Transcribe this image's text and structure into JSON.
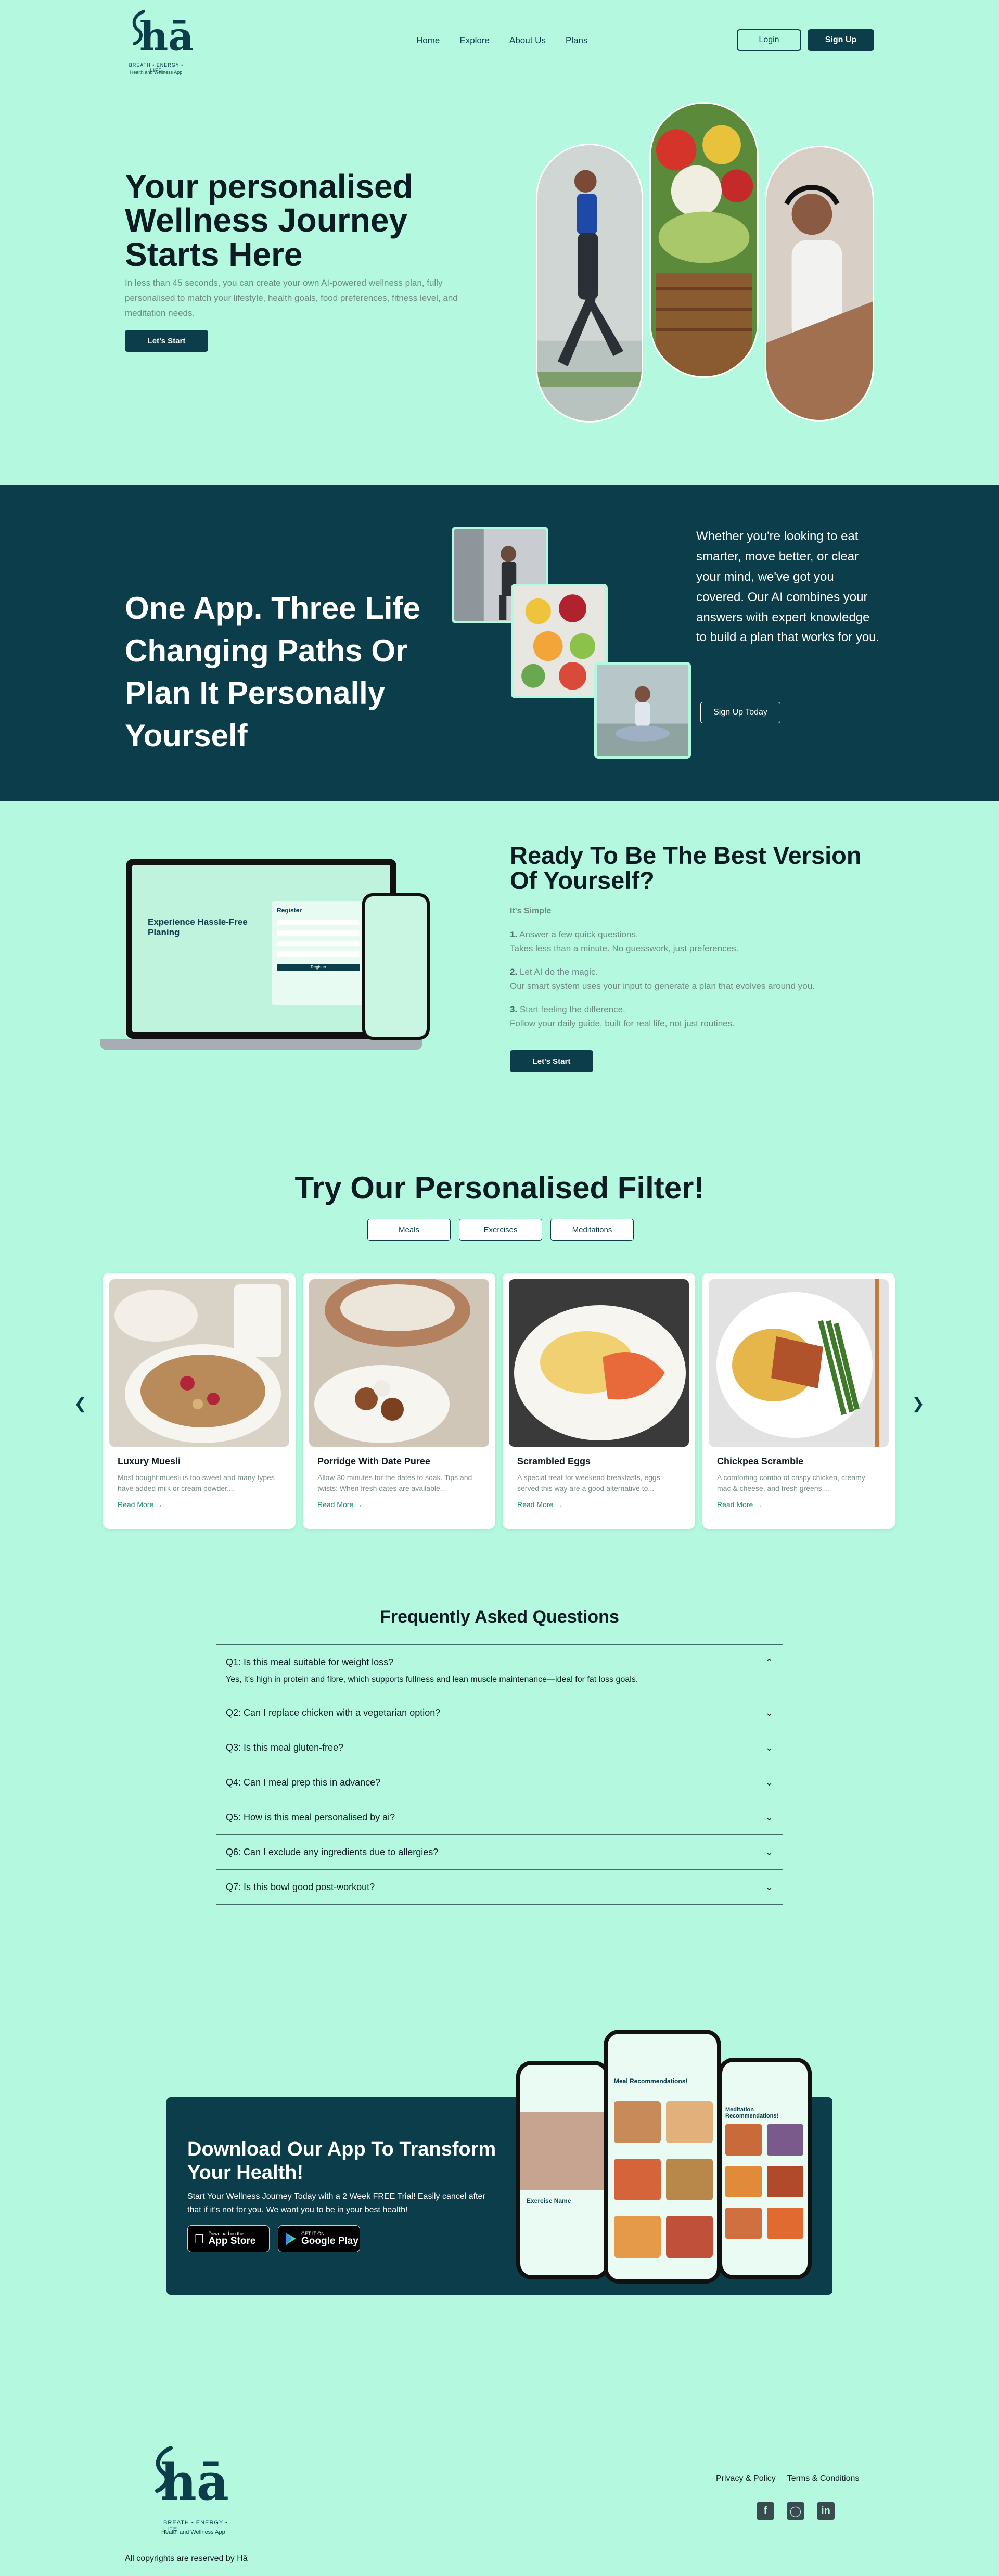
{
  "brand": {
    "logo_mark": "hā",
    "logo_line1": "BREATH • ENERGY • LIFE",
    "logo_line2": "Health and Wellness App"
  },
  "nav": {
    "links": [
      "Home",
      "Explore",
      "About Us",
      "Plans"
    ],
    "login_label": "Login",
    "signup_label": "Sign Up"
  },
  "hero": {
    "title": "Your personalised Wellness Journey Starts Here",
    "description": "In less than 45 seconds, you can create your own AI-powered wellness plan, fully personalised to match your lifestyle, health goals, food preferences, fitness level, and meditation needs.",
    "cta_label": "Let's Start"
  },
  "band": {
    "title": "One App. Three Life Changing Paths Or Plan It Personally Yourself",
    "text": "Whether you're looking to eat smarter, move better, or clear your mind, we've got you covered. Our AI combines your answers with expert knowledge to build a plan that works for you.",
    "cta_label": "Sign Up Today"
  },
  "ready": {
    "title": "Ready To Be The Best Version Of Yourself?",
    "subtitle": "It's Simple",
    "steps": [
      {
        "num": "1.",
        "head": "Answer a few quick questions.",
        "body": "Takes less than a minute. No guesswork, just preferences."
      },
      {
        "num": "2.",
        "head": "Let AI do the magic.",
        "body": "Our smart system uses your input to generate a plan that evolves around you."
      },
      {
        "num": "3.",
        "head": "Start feeling the difference.",
        "body": "Follow your daily guide, built for real life, not just routines."
      }
    ],
    "cta_label": "Let's Start",
    "laptop": {
      "heading": "Experience Hassle-Free Planing",
      "register": "Register",
      "register_button": "Register"
    }
  },
  "filter": {
    "title": "Try Our Personalised Filter!",
    "tabs": [
      "Meals",
      "Exercises",
      "Meditations"
    ],
    "cards": [
      {
        "title": "Luxury Muesli",
        "desc": "Most bought muesli is too sweet and many types have added milk or cream powder....",
        "link": "Read More →"
      },
      {
        "title": "Porridge With Date Puree",
        "desc": "Allow 30 minutes for the dates to soak. Tips and twists: When fresh dates are available...",
        "link": "Read More →"
      },
      {
        "title": "Scrambled Eggs",
        "desc": "A special treat for weekend breakfasts, eggs served this way are a good alternative to...",
        "link": "Read More →"
      },
      {
        "title": "Chickpea Scramble",
        "desc": "A comforting combo of crispy chicken, creamy mac & cheese, and fresh greens,...",
        "link": "Read More →"
      }
    ]
  },
  "faq": {
    "title": "Frequently Asked Questions",
    "items": [
      {
        "q": "Q1: Is this meal suitable for weight loss?",
        "a": "Yes, it's high in protein and fibre, which supports fullness and lean muscle maintenance—ideal for fat loss goals.",
        "open": true
      },
      {
        "q": "Q2: Can I replace chicken with a vegetarian option?",
        "open": false
      },
      {
        "q": "Q3: Is this meal gluten-free?",
        "open": false
      },
      {
        "q": "Q4: Can I meal prep this in advance?",
        "open": false
      },
      {
        "q": "Q5: How is this meal personalised by ai?",
        "open": false
      },
      {
        "q": "Q6: Can I exclude any ingredients due to allergies?",
        "open": false
      },
      {
        "q": "Q7: Is this bowl good post-workout?",
        "open": false
      }
    ]
  },
  "app": {
    "title": "Download Our App To Transform Your Health!",
    "description": "Start Your Wellness Journey Today with a 2 Week FREE Trial! Easily cancel after that if it's not for you. We want you to be in your best health!",
    "appstore_small": "Download on the",
    "appstore_big": "App Store",
    "play_small": "GET IT ON",
    "play_big": "Google Play",
    "phone_headings": [
      "Exercise Name",
      "Meal Recommendations!",
      "Meditation Recommendations!"
    ]
  },
  "footer": {
    "links": [
      "Privacy & Policy",
      "Terms & Conditions"
    ],
    "copyright": "All copyrights are reserved by Hā"
  },
  "colors": {
    "background": "#b3f8df",
    "primary": "#0c3d4a",
    "muted_text": "#6c8a84",
    "link": "#1b8a74"
  },
  "icons": [
    "chevron-left-icon",
    "chevron-right-icon",
    "chevron-up-icon",
    "chevron-down-icon",
    "apple-icon",
    "google-play-icon",
    "facebook-icon",
    "instagram-icon",
    "linkedin-icon"
  ]
}
